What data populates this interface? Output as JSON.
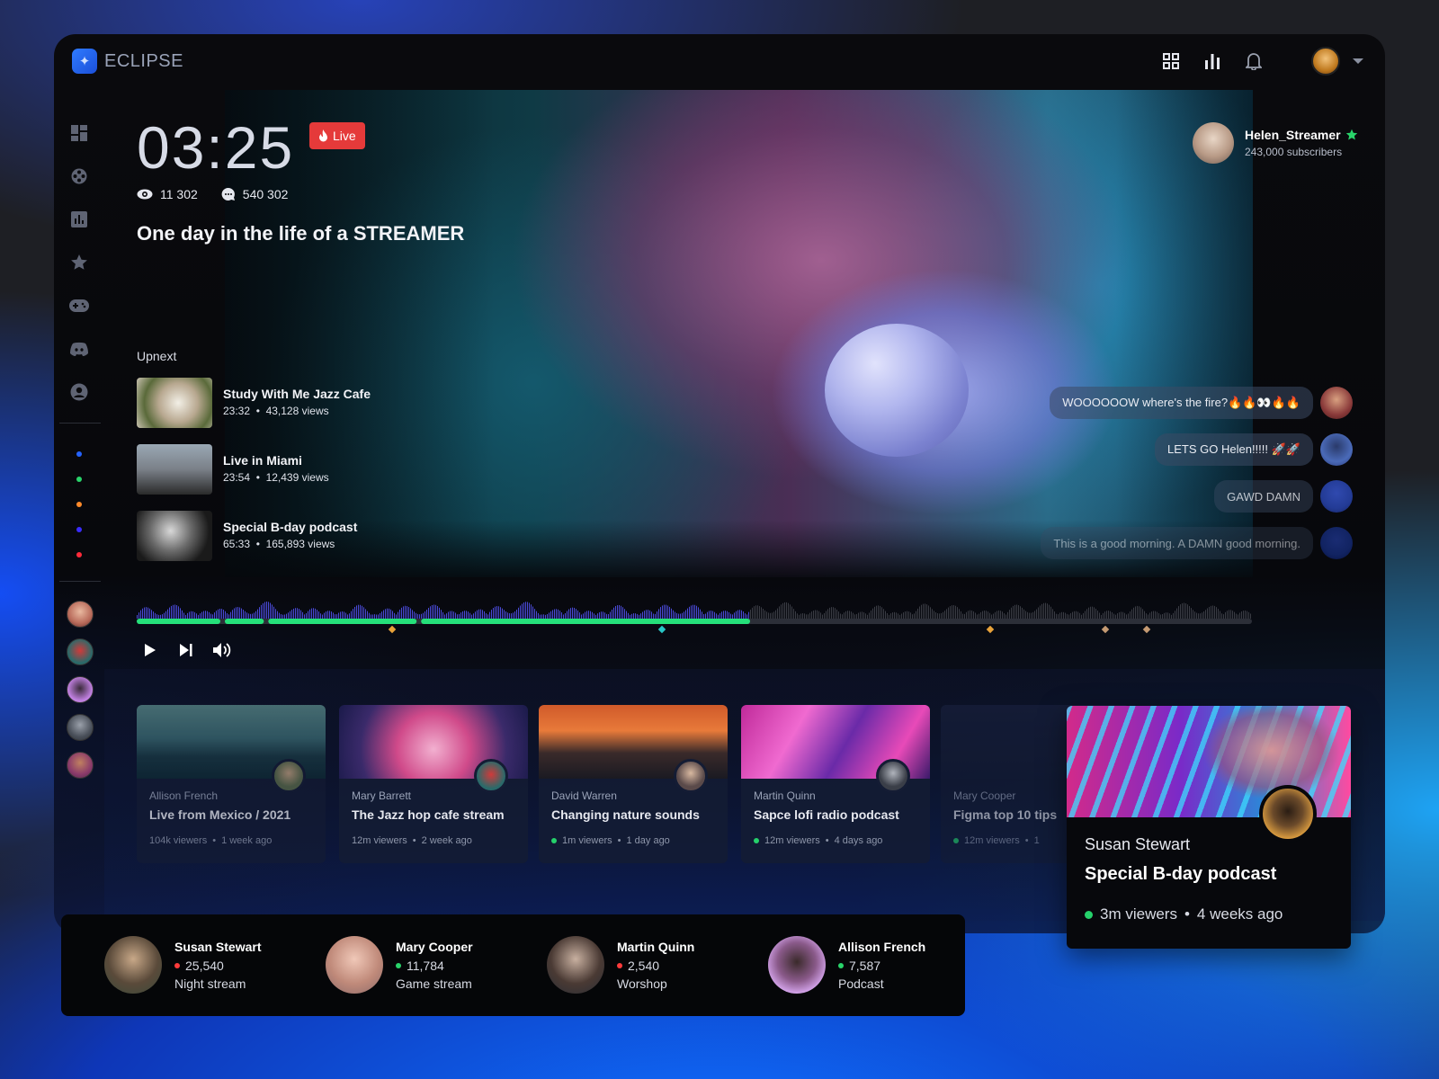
{
  "app": {
    "name": "ECLIPSE"
  },
  "topbar": {
    "icons": [
      "grid-icon",
      "chart-icon",
      "bell-icon"
    ]
  },
  "sidebar": {
    "icons": [
      "dashboard-icon",
      "film-reel-icon",
      "bar-chart-icon",
      "star-icon",
      "gamepad-icon",
      "discord-icon",
      "user-circle-icon"
    ],
    "status_dots": [
      "#2563ff",
      "#29d46a",
      "#ff8a2a",
      "#3a2cff",
      "#ff2a3a"
    ]
  },
  "hero": {
    "clock": "03:25",
    "live_label": "Live",
    "viewers": "11 302",
    "comments": "540 302",
    "title": "One day in the life of a STREAMER",
    "streamer": {
      "name": "Helen_Streamer",
      "subscribers": "243,000 subscribers"
    }
  },
  "upnext": {
    "label": "Upnext",
    "items": [
      {
        "title": "Study With Me Jazz Cafe",
        "duration": "23:32",
        "views": "43,128 views"
      },
      {
        "title": "Live in Miami",
        "duration": "23:54",
        "views": "12,439 views"
      },
      {
        "title": "Special B-day podcast",
        "duration": "65:33",
        "views": "165,893 views"
      }
    ]
  },
  "chat": [
    {
      "text": "WOOOOOOW where's the fire?🔥🔥👀🔥🔥"
    },
    {
      "text": "LETS GO Helen!!!!! 🚀🚀"
    },
    {
      "text": "GAWD DAMN"
    },
    {
      "text": "This is a good morning. A DAMN good morning."
    }
  ],
  "player": {
    "progress": 0.55,
    "controls": [
      "play-icon",
      "skip-next-icon",
      "volume-icon"
    ]
  },
  "cards": [
    {
      "author": "Allison French",
      "title": "Live from Mexico / 2021",
      "viewers": "104k viewers",
      "ago": "1 week ago",
      "live": false
    },
    {
      "author": "Mary Barrett",
      "title": "The Jazz hop cafe stream",
      "viewers": "12m viewers",
      "ago": "2 week ago",
      "live": false
    },
    {
      "author": "David Warren",
      "title": "Changing nature sounds",
      "viewers": "1m viewers",
      "ago": "1 day ago",
      "live": true
    },
    {
      "author": "Martin Quinn",
      "title": "Sapce lofi radio podcast",
      "viewers": "12m viewers",
      "ago": "4 days ago",
      "live": true
    },
    {
      "author": "Mary Cooper",
      "title": "Figma top 10 tips",
      "viewers": "12m viewers",
      "ago": "1",
      "live": true
    }
  ],
  "featured": {
    "author": "Susan Stewart",
    "title": "Special B-day podcast",
    "viewers": "3m viewers",
    "ago": "4 weeks ago"
  },
  "people": [
    {
      "name": "Susan Stewart",
      "count": "25,540",
      "type": "Night stream",
      "status": "#ff3b3b"
    },
    {
      "name": "Mary Cooper",
      "count": "11,784",
      "type": "Game stream",
      "status": "#29d46a"
    },
    {
      "name": "Martin Quinn",
      "count": "2,540",
      "type": "Worshop",
      "status": "#ff3b3b"
    },
    {
      "name": "Allison French",
      "count": "7,587",
      "type": "Podcast",
      "status": "#29d46a"
    }
  ]
}
